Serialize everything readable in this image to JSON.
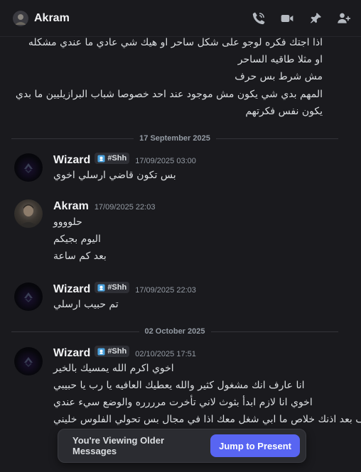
{
  "header": {
    "title": "Akram",
    "icons": [
      "phone-call-icon",
      "video-camera-icon",
      "pin-icon",
      "add-friend-icon"
    ]
  },
  "top_continuation": [
    "اذا اجتك فكره لوجو على شكل ساحر او هيك شي عادي ما عندي مشكله",
    "او مثلا طاقيه الساحر",
    "مش شرط بس حرف",
    "المهم بدي شي يكون مش موجود عند احد خصوصا شباب البرازيليين ما بدي",
    "يكون نفس فكرتهم"
  ],
  "dividers": [
    "17 September 2025",
    "02 October 2025"
  ],
  "messages": [
    {
      "author": "Wizard",
      "tag": "#Shh",
      "timestamp": "17/09/2025 03:00",
      "lines": [
        "بس تكون قاضي ارسلي اخوي"
      ]
    },
    {
      "author": "Akram",
      "timestamp": "17/09/2025 22:03",
      "lines": [
        "حلوووو",
        "اليوم بجيكم",
        "بعد كم ساعة"
      ]
    },
    {
      "author": "Wizard",
      "tag": "#Shh",
      "timestamp": "17/09/2025 22:03",
      "lines": [
        "تم حبيب ارسلي"
      ]
    },
    {
      "author": "Wizard",
      "tag": "#Shh",
      "timestamp": "02/10/2025 17:51",
      "lines": [
        "اخوي اكرم الله يمسيك بالخير",
        "انا عارف انك مشغول كثير والله يعطيك العافيه يا رب يا حبيبي",
        "اخوي انا لازم ابدأ بثوث لاني تأخرت مرررره والوضع سيء عندي",
        "ف بعد اذنك خلاص ما ابي شغل معك اذا في مجال بس تحولي الفلوس خليني"
      ]
    }
  ],
  "older_bar": {
    "label": "You're Viewing Older Messages",
    "button": "Jump to Present"
  },
  "colors": {
    "background": "#1a1a1e",
    "accent": "#5865f2",
    "text": "#dbdee1",
    "muted": "#949ba4"
  }
}
